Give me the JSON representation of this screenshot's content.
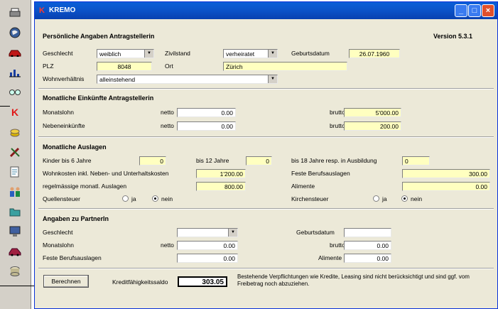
{
  "window": {
    "title": "KREMO",
    "app_icon": "K"
  },
  "icons": [
    "printer-icon",
    "globe-icon",
    "car-icon",
    "chart-icon",
    "glasses-icon",
    "k-icon",
    "coins-icon",
    "tools-icon",
    "document-icon",
    "family-icon",
    "folder-icon",
    "computer-icon",
    "car-red-icon",
    "database-icon"
  ],
  "header": {
    "title": "Persönliche Angaben Antragstellerin",
    "version": "Version  5.3.1"
  },
  "personal": {
    "geschlecht_label": "Geschlecht",
    "geschlecht_value": "weiblich",
    "zivilstand_label": "Zivilstand",
    "zivilstand_value": "verheiratet",
    "geburtsdatum_label": "Geburtsdatum",
    "geburtsdatum_value": "26.07.1960",
    "plz_label": "PLZ",
    "plz_value": "8048",
    "ort_label": "Ort",
    "ort_value": "Zürich",
    "wohnverhaeltnis_label": "Wohnverhältnis",
    "wohnverhaeltnis_value": "alleinstehend"
  },
  "einkuenfte": {
    "title": "Monatliche Einkünfte Antragstellerin",
    "monatslohn_label": "Monatslohn",
    "monatslohn_netto": "0.00",
    "monatslohn_brutto": "5'000.00",
    "neben_label": "Nebeneinkünfte",
    "neben_netto": "0.00",
    "neben_brutto": "200.00",
    "netto": "netto",
    "brutto": "brutto"
  },
  "auslagen": {
    "title": "Monatliche Auslagen",
    "kinder6_label": "Kinder bis 6 Jahre",
    "kinder6_value": "0",
    "kinder12_label": "bis 12 Jahre",
    "kinder12_value": "0",
    "kinder18_label": "bis 18 Jahre resp. in Ausbildung",
    "kinder18_value": "0",
    "wohnkosten_label": "Wohnkosten inkl. Neben- und Unterhaltskosten",
    "wohnkosten_value": "1'200.00",
    "berufsauslagen_label": "Feste Berufsauslagen",
    "berufsauslagen_value": "300.00",
    "regel_label": "regelmässige monatl. Auslagen",
    "regel_value": "800.00",
    "alimente_label": "Alimente",
    "alimente_value": "0.00",
    "quellensteuer_label": "Quellensteuer",
    "kirchensteuer_label": "Kirchensteuer",
    "ja": "ja",
    "nein": "nein"
  },
  "partner": {
    "title": "Angaben zu PartnerIn",
    "geschlecht_label": "Geschlecht",
    "geschlecht_value": "",
    "geburtsdatum_label": "Geburtsdatum",
    "geburtsdatum_value": "",
    "monatslohn_label": "Monatslohn",
    "netto": "netto",
    "netto_value": "0.00",
    "brutto": "brutto",
    "brutto_value": "0.00",
    "berufsauslagen_label": "Feste Berufsauslagen",
    "berufsauslagen_value": "0.00",
    "alimente_label": "Alimente",
    "alimente_value": "0.00"
  },
  "footer": {
    "berechnen": "Berechnen",
    "saldo_label": "Kreditfähigkeitssaldo",
    "saldo_value": "303.05",
    "note": "Bestehende Verpflichtungen wie Kredite, Leasing sind nicht berücksichtigt und sind ggf. vom Freibetrag noch abzuziehen."
  }
}
